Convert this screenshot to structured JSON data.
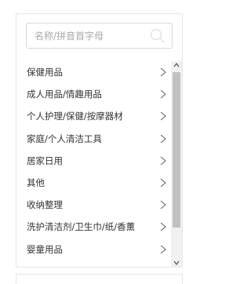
{
  "search": {
    "placeholder": "名称/拼音首字母",
    "icon": "search-icon"
  },
  "categories": [
    {
      "label": "保健用品"
    },
    {
      "label": "成人用品/情趣用品"
    },
    {
      "label": "个人护理/保健/按摩器材"
    },
    {
      "label": "家庭/个人清洁工具"
    },
    {
      "label": "居家日用"
    },
    {
      "label": "其他"
    },
    {
      "label": "收纳整理"
    },
    {
      "label": "洗护清洁剂/卫生巾/纸/香薰"
    },
    {
      "label": "婴童用品"
    }
  ],
  "icons": {
    "item_arrow": "chevron-right-icon",
    "scroll_up": "scroll-up-arrow-icon",
    "scroll_down": "scroll-down-arrow-icon"
  },
  "colors": {
    "text": "#333333",
    "placeholder": "#a9a9a9",
    "border": "#d9d9d9",
    "scroll_track": "#f1f1f1",
    "scroll_thumb": "#c1c1c1"
  }
}
